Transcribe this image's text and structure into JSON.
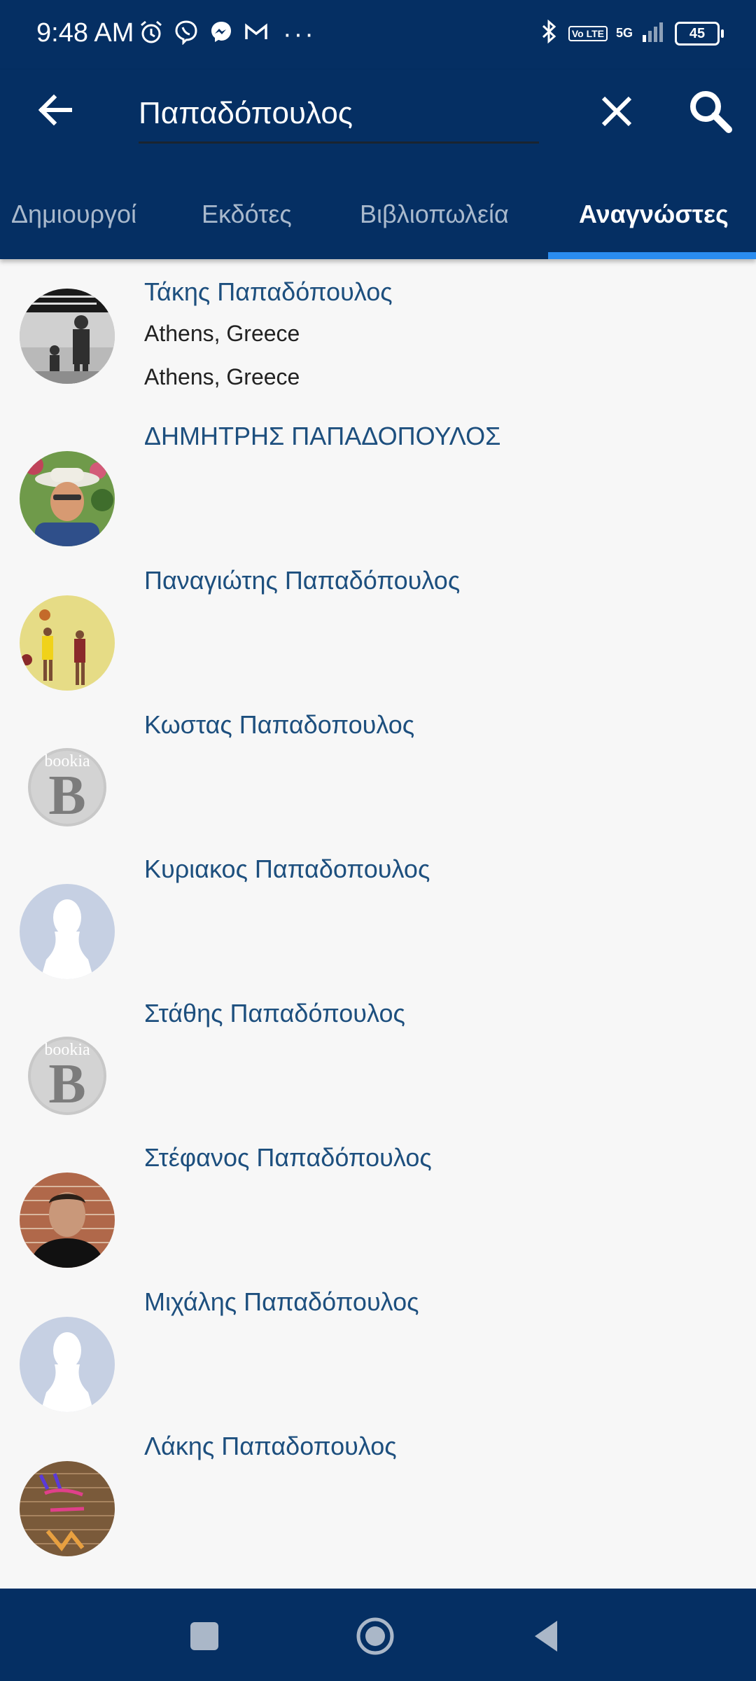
{
  "status": {
    "time": "9:48 AM",
    "battery": "45",
    "network": "5G",
    "volte": "Vo LTE"
  },
  "search": {
    "query": "Παπαδόπουλος"
  },
  "tabs": [
    {
      "label": "Δημιουργοί",
      "active": false
    },
    {
      "label": "Εκδότες",
      "active": false
    },
    {
      "label": "Βιβλιοπωλεία",
      "active": false
    },
    {
      "label": "Αναγνώστες",
      "active": true
    }
  ],
  "results": [
    {
      "name": "Τάκης Παπαδόπουλος",
      "line1": "Athens, Greece",
      "line2": "Athens, Greece",
      "avatar": "photo-father-son"
    },
    {
      "name": "ΔΗΜΗΤΡΗΣ ΠΑΠΑΔΟΠΟΥΛΟΣ",
      "avatar": "photo-man-hat"
    },
    {
      "name": "Παναγιώτης Παπαδόπουλος",
      "avatar": "photo-basketball"
    },
    {
      "name": "Κωστας Παπαδοπουλος",
      "avatar": "bookia-logo",
      "logo_text": "bookia",
      "logo_letter": "B"
    },
    {
      "name": "Κυριακος Παπαδοπουλος",
      "avatar": "default-silhouette"
    },
    {
      "name": "Στάθης Παπαδόπουλος",
      "avatar": "bookia-logo",
      "logo_text": "bookia",
      "logo_letter": "B"
    },
    {
      "name": "Στέφανος Παπαδόπουλος",
      "avatar": "photo-man-brick-wall"
    },
    {
      "name": "Μιχάλης Παπαδόπουλος",
      "avatar": "default-silhouette"
    },
    {
      "name": "Λάκης Παπαδοπουλος",
      "avatar": "photo-pink-floyd-wall"
    }
  ],
  "colors": {
    "appbar": "#052f63",
    "tab_indicator": "#2a8cf0",
    "name_text": "#1d4f7e",
    "background": "#f7f7f7"
  }
}
